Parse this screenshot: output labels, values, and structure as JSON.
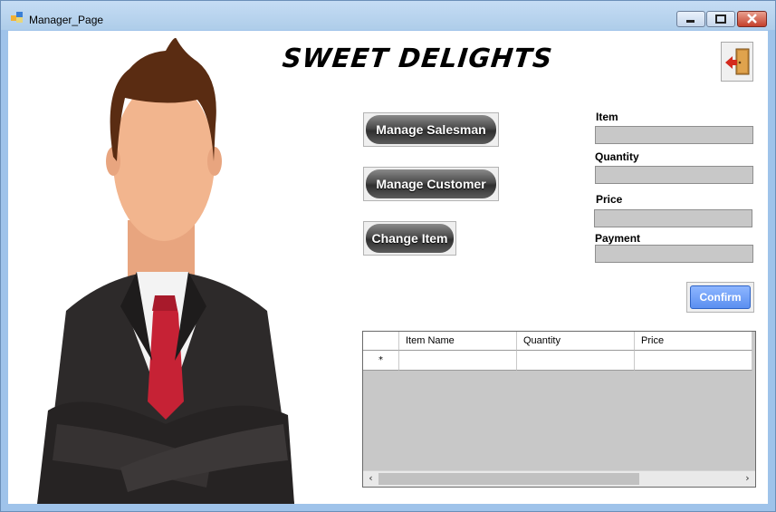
{
  "window": {
    "title": "Manager_Page"
  },
  "header": {
    "brand": "SWEET DELIGHTS"
  },
  "icons": {
    "app": "app-icon",
    "exit": "exit-door-icon",
    "avatar": "manager-avatar-image"
  },
  "nav": {
    "manage_salesman": "Manage Salesman",
    "manage_customer": "Manage Customer",
    "change_item": "Change Item"
  },
  "form": {
    "item_label": "Item",
    "item_value": "",
    "quantity_label": "Quantity",
    "quantity_value": "",
    "price_label": "Price",
    "price_value": "",
    "payment_label": "Payment",
    "payment_value": "",
    "confirm_label": "Confirm"
  },
  "grid": {
    "columns": [
      "Item Name",
      "Quantity",
      "Price"
    ],
    "new_row_marker": "*",
    "rows": []
  }
}
